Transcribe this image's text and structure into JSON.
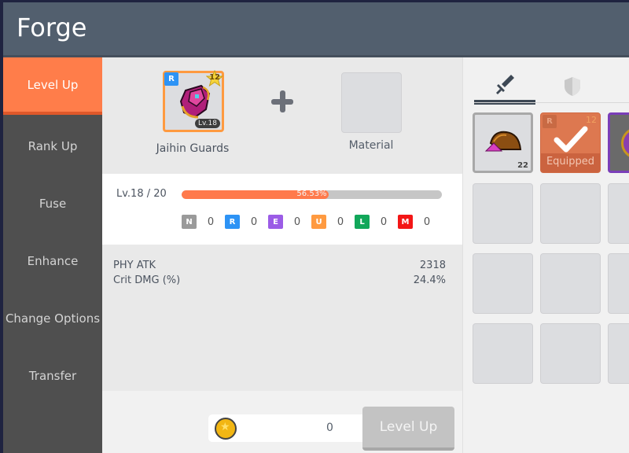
{
  "header": {
    "title": "Forge"
  },
  "sidebar": {
    "items": [
      {
        "label": "Level Up",
        "active": true
      },
      {
        "label": "Rank Up",
        "active": false
      },
      {
        "label": "Fuse",
        "active": false
      },
      {
        "label": "Enhance",
        "active": false
      },
      {
        "label": "Change Options",
        "active": false
      },
      {
        "label": "Transfer",
        "active": false
      }
    ]
  },
  "forge": {
    "item": {
      "name": "Jaihin Guards",
      "rank": "R",
      "stars": "12",
      "level_tag": "Lv.18",
      "icon": "gauntlet-icon"
    },
    "plus_icon": "plus-icon",
    "material_label": "Material",
    "level": {
      "text": "Lv.18 / 20",
      "progress_percent": 56.53,
      "progress_label": "56.53%"
    },
    "ranks": [
      {
        "letter": "N",
        "color": "#9a9a9a",
        "count": "0"
      },
      {
        "letter": "R",
        "color": "#2d93f5",
        "count": "0"
      },
      {
        "letter": "E",
        "color": "#9b5ce6",
        "count": "0"
      },
      {
        "letter": "U",
        "color": "#ff9a40",
        "count": "0"
      },
      {
        "letter": "L",
        "color": "#12a75a",
        "count": "0"
      },
      {
        "letter": "M",
        "color": "#f31616",
        "count": "0"
      }
    ],
    "stats": [
      {
        "name": "PHY ATK",
        "value": "2318"
      },
      {
        "name": "Crit DMG (%)",
        "value": "24.4%"
      }
    ],
    "cost": {
      "icon": "gold-coin-icon",
      "value": "0"
    },
    "level_up_button": "Level Up"
  },
  "inventory": {
    "tabs": [
      {
        "icon": "sword-icon",
        "active": true
      },
      {
        "icon": "shield-icon",
        "active": false
      },
      {
        "icon": "accessory-icon",
        "active": false
      }
    ],
    "slots": [
      {
        "type": "material",
        "quantity": "22"
      },
      {
        "type": "equipped",
        "rank": "R",
        "stars": "12",
        "label": "Equipped"
      },
      {
        "type": "epic-item"
      }
    ]
  },
  "colors": {
    "accent": "#ff7d4a",
    "header": "#525f6e",
    "sidebar": "#4f4f4f"
  }
}
